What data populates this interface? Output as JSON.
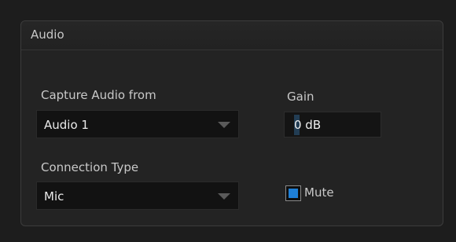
{
  "panel": {
    "title": "Audio"
  },
  "capture": {
    "label": "Capture Audio from",
    "selected": "Audio 1"
  },
  "gain": {
    "label": "Gain",
    "value": "0 dB"
  },
  "connection": {
    "label": "Connection Type",
    "selected": "Mic"
  },
  "mute": {
    "label": "Mute",
    "checked": true
  },
  "icons": {
    "dropdown": "chevron-down-icon",
    "checkbox": "checkbox-checked-icon"
  },
  "colors": {
    "accent": "#1e7fd6",
    "panel_bg": "#232323",
    "page_bg": "#1d1d1d"
  }
}
